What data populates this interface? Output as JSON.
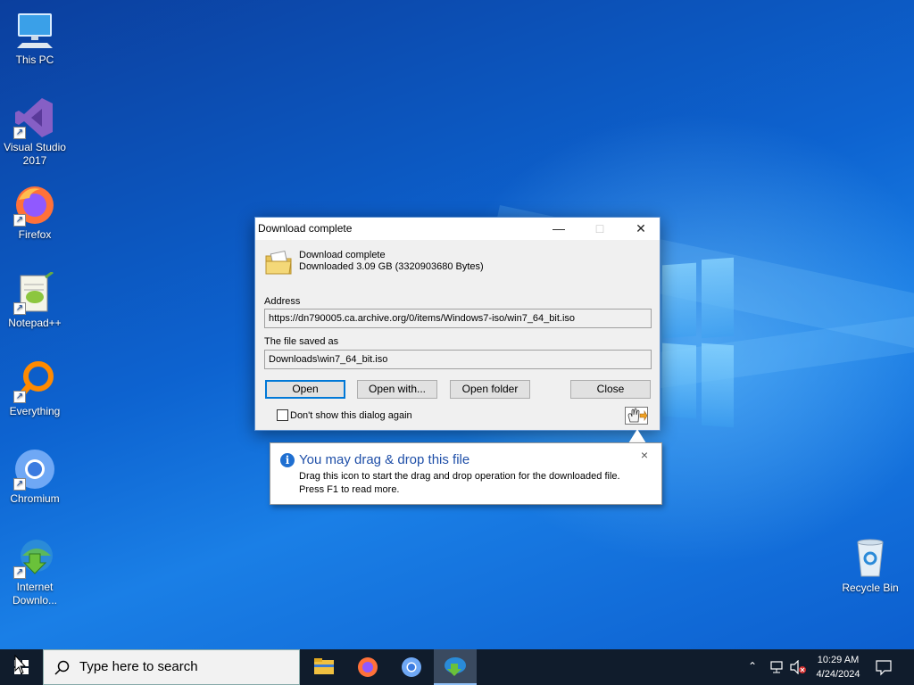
{
  "desktop": {
    "icons": [
      {
        "label": "This PC"
      },
      {
        "label": "Visual Studio 2017"
      },
      {
        "label": "Firefox"
      },
      {
        "label": "Notepad++"
      },
      {
        "label": "Everything"
      },
      {
        "label": "Chromium"
      },
      {
        "label": "Internet Downlo..."
      },
      {
        "label": "Recycle Bin"
      }
    ]
  },
  "dialog": {
    "title": "Download complete",
    "heading": "Download complete",
    "size_text": "Downloaded 3.09  GB (3320903680 Bytes)",
    "address_label": "Address",
    "address_value": "https://dn790005.ca.archive.org/0/items/Windows7-iso/win7_64_bit.iso",
    "saved_label": "The file saved as",
    "saved_value": "Downloads\\win7_64_bit.iso",
    "buttons": {
      "open": "Open",
      "open_with": "Open with...",
      "open_folder": "Open folder",
      "close": "Close"
    },
    "checkbox_label": "Don't show this dialog again",
    "checkbox_checked": false
  },
  "tooltip": {
    "title": "You may drag & drop this file",
    "line1": "Drag this icon to start the drag and drop operation for the downloaded file.",
    "line2": "Press F1 to read more.",
    "close_glyph": "×"
  },
  "taskbar": {
    "search_placeholder": "Type here to search",
    "apps": [
      "file-explorer",
      "firefox",
      "chromium",
      "internet-download-manager"
    ],
    "time": "10:29 AM",
    "date": "4/24/2024"
  },
  "colors": {
    "accent": "#0078d7",
    "taskbar": "#101c2c",
    "info_blue": "#1f6fd1"
  }
}
